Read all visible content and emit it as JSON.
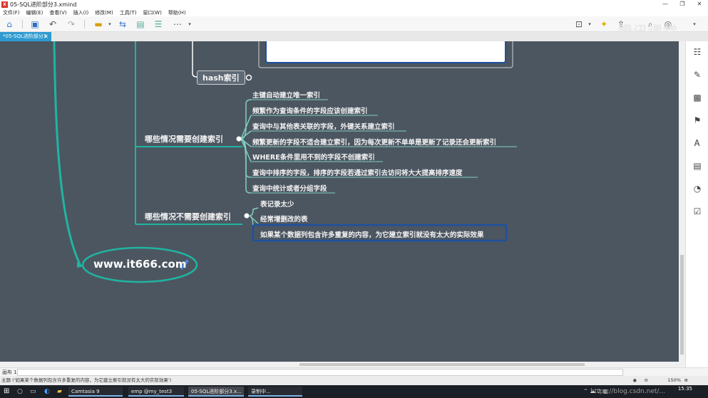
{
  "window": {
    "title": "05-SQL进阶部分3.xmind",
    "controls": [
      "—",
      "❐",
      "✕"
    ]
  },
  "menu": [
    "文件(F)",
    "编辑(E)",
    "查看(V)",
    "插入(I)",
    "修改(M)",
    "工具(T)",
    "窗口(W)",
    "帮助(H)"
  ],
  "tab": {
    "label": "*05-SQL进阶部分3",
    "close": "✕"
  },
  "watermark": "腾讯课堂",
  "mindmap": {
    "hash_topic": "hash索引",
    "need_index_topic": "哪些情况需要创建索引",
    "need_index_items": [
      "主键自动建立唯一索引",
      "频繁作为查询条件的字段应该创建索引",
      "查询中与其他表关联的字段，外键关系建立索引",
      "频繁更新的字段不适合建立索引，因为每次更新不单单是更新了记录还会更新索引",
      "WHERE条件里用不到的字段不创建索引",
      "查询中排序的字段，排序的字段若通过索引去访问将大大提高排序速度",
      "查询中统计或者分组字段"
    ],
    "no_index_topic": "哪些情况不需要创建索引",
    "no_index_items": [
      "表记录太少",
      "经常增删改的表",
      "如果某个数据列包含许多重复的内容，为它建立索引就没有太大的实际效果"
    ],
    "url_topic": "www.it666.com"
  },
  "sheetbar": {
    "sheet": "画布 1"
  },
  "status": {
    "text": "主题 ('如果某个数据列包含许多重复的内容，为它建立索引就没有太大的实际效果')",
    "zoom": "150%",
    "zoom_minus": "⊖",
    "zoom_plus": "⊕"
  },
  "taskbar": {
    "apps": [
      "Camtasia 9",
      "emp @my_test3 (m...",
      "05-SQL进阶部分3.x...",
      "录制中..."
    ],
    "url_watermark": "https://blog.csdn.net/...",
    "time": "15:35"
  },
  "colors": {
    "canvas": "#4c5661",
    "teal_line": "#1fb5a2",
    "leaf_line": "#7fd0c0",
    "selection": "#1e50a0",
    "tab": "#2e9ad0"
  }
}
